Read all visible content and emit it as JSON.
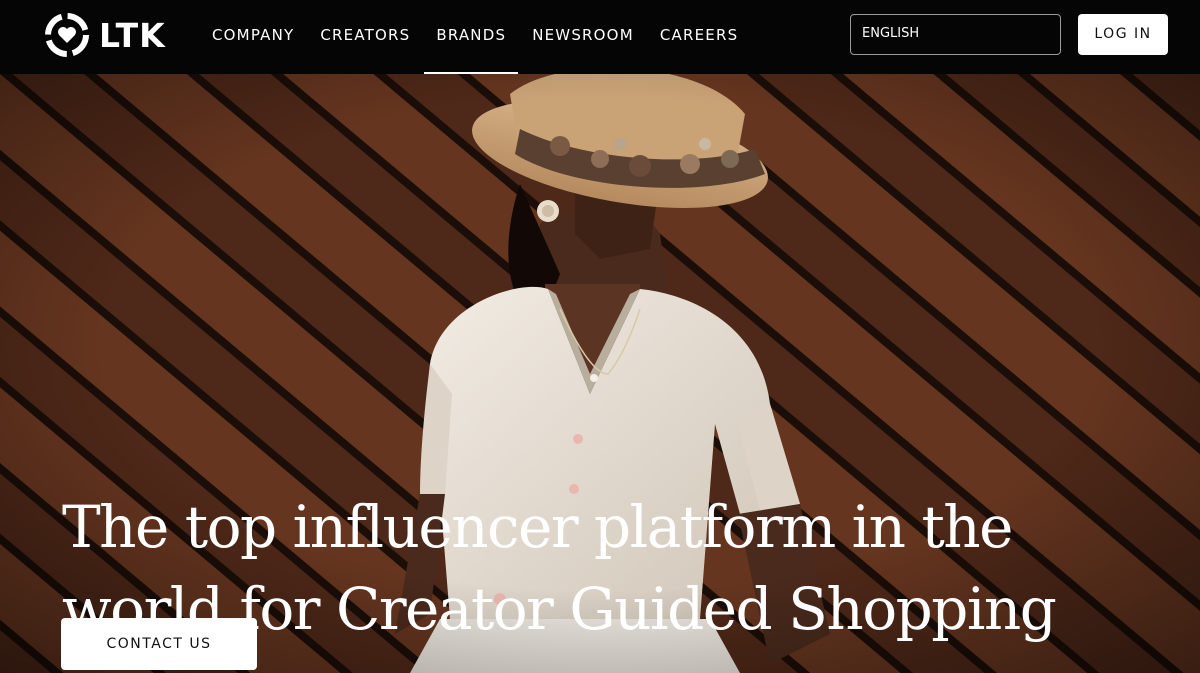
{
  "brand": {
    "name": "LTK",
    "logo_icon": "ltk-heart-ring-icon"
  },
  "nav": {
    "items": [
      {
        "label": "COMPANY"
      },
      {
        "label": "CREATORS"
      },
      {
        "label": "BRANDS",
        "active": true
      },
      {
        "label": "NEWSROOM"
      },
      {
        "label": "CAREERS"
      }
    ]
  },
  "header": {
    "language": "ENGLISH",
    "login_label": "LOG IN"
  },
  "hero": {
    "headline_line1": "The top influencer platform in the",
    "headline_line2": "world for Creator Guided Shopping",
    "cta_label": "CONTACT US",
    "image_subject": "woman in straw hat with dried flowers and cream knit cardigan against diagonal wood plank wall"
  },
  "colors": {
    "header_bg": "#050505",
    "plank": "#5a2f1f",
    "plank_gap": "#1b0d07",
    "text_light": "#ffffff",
    "button_bg": "#ffffff",
    "button_text": "#111111"
  }
}
